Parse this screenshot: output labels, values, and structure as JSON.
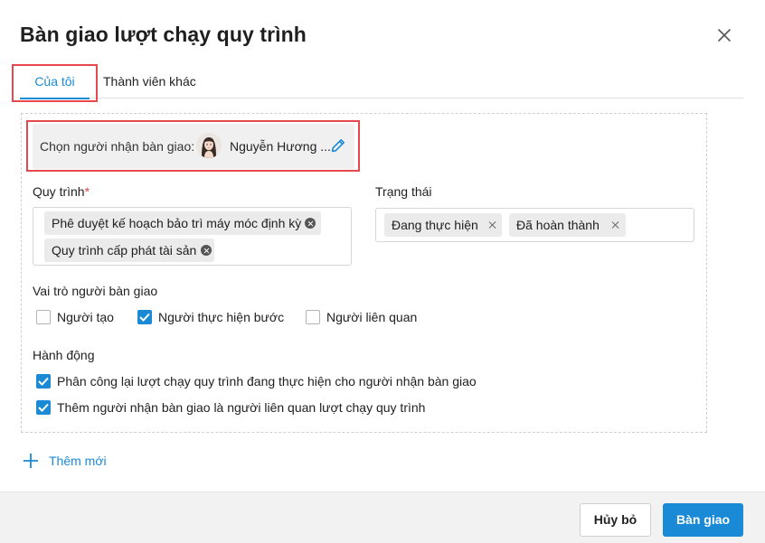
{
  "dialog": {
    "title": "Bàn giao lượt chạy quy trình"
  },
  "tabs": [
    {
      "label": "Của tôi",
      "active": true
    },
    {
      "label": "Thành viên khác",
      "active": false
    }
  ],
  "receiver": {
    "label": "Chọn người nhận bàn giao:",
    "name": "Nguyễn Hương ..."
  },
  "process": {
    "label": "Quy trình",
    "required_mark": "*",
    "chips": [
      "Phê duyệt kế hoạch bảo trì máy móc định kỳ",
      "Quy trình cấp phát tài sản"
    ]
  },
  "status": {
    "label": "Trạng thái",
    "chips": [
      "Đang thực hiện",
      "Đã hoàn thành"
    ]
  },
  "roles": {
    "label": "Vai trò người bàn giao",
    "options": [
      {
        "label": "Người tạo",
        "checked": false
      },
      {
        "label": "Người thực hiện bước",
        "checked": true
      },
      {
        "label": "Người liên quan",
        "checked": false
      }
    ]
  },
  "actions": {
    "label": "Hành động",
    "options": [
      {
        "label": "Phân công lại lượt chạy quy trình đang thực hiện cho người nhận bàn giao",
        "checked": true
      },
      {
        "label": "Thêm người nhận bàn giao là người liên quan lượt chạy quy trình",
        "checked": true
      }
    ]
  },
  "add_new": "Thêm mới",
  "footer": {
    "cancel": "Hủy bỏ",
    "submit": "Bàn giao"
  },
  "colors": {
    "accent": "#1a8ad6",
    "highlight": "#e5484d",
    "required": "#e5484d"
  }
}
